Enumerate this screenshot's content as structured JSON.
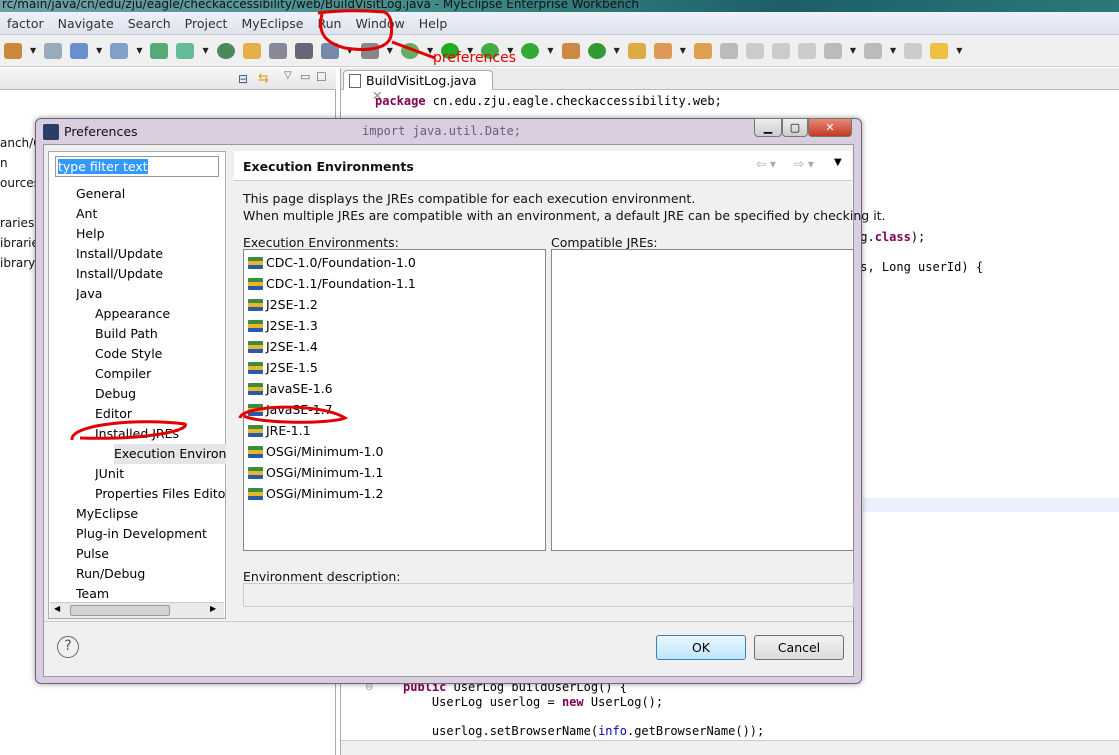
{
  "window": {
    "title": "rc/main/java/cn/edu/zju/eagle/checkaccessibility/web/BuildVisitLog.java - MyEclipse Enterprise Workbench"
  },
  "menu": [
    "factor",
    "Navigate",
    "Search",
    "Project",
    "MyEclipse",
    "Run",
    "Window",
    "Help"
  ],
  "annotation": {
    "text": "preferences",
    "color": "#e00000"
  },
  "left_panel": {
    "fragments": [
      "anch/C",
      "n",
      "ources",
      "raries",
      "ibraries",
      "ibrary"
    ]
  },
  "editor": {
    "tab": "BuildVisitLog.java",
    "lines": {
      "package_kw": "package",
      "package_rest": " cn.edu.zju.eagle.checkaccessibility.web;",
      "import": "import java.util.Date;",
      "class_pre": "og.",
      "class_kw": "class",
      "class_post": ");",
      "method_sig": "es, Long userId) {",
      "pub_kw": "public",
      "pub_rest": " UserLog buildUserLog() {",
      "ul_pre": "    UserLog userlog = ",
      "ul_new": "new",
      "ul_post": " UserLog();",
      "sb_pre": "    userlog.setBrowserName(",
      "sb_info": "info",
      "sb_post": ".getBrowserName());"
    }
  },
  "dialog": {
    "title": "Preferences",
    "filter_text": "type filter text",
    "tree": [
      {
        "label": "General",
        "level": 0
      },
      {
        "label": "Ant",
        "level": 0
      },
      {
        "label": "Help",
        "level": 0
      },
      {
        "label": "Install/Update",
        "level": 0
      },
      {
        "label": "Install/Update",
        "level": 0
      },
      {
        "label": "Java",
        "level": 0
      },
      {
        "label": "Appearance",
        "level": 1
      },
      {
        "label": "Build Path",
        "level": 1
      },
      {
        "label": "Code Style",
        "level": 1
      },
      {
        "label": "Compiler",
        "level": 1
      },
      {
        "label": "Debug",
        "level": 1
      },
      {
        "label": "Editor",
        "level": 1
      },
      {
        "label": "Installed JREs",
        "level": 1
      },
      {
        "label": "Execution Environments",
        "level": 2,
        "selected": true
      },
      {
        "label": "JUnit",
        "level": 1
      },
      {
        "label": "Properties Files Editor",
        "level": 1
      },
      {
        "label": "MyEclipse",
        "level": 0
      },
      {
        "label": "Plug-in Development",
        "level": 0
      },
      {
        "label": "Pulse",
        "level": 0
      },
      {
        "label": "Run/Debug",
        "level": 0
      },
      {
        "label": "Team",
        "level": 0
      }
    ],
    "page_title": "Execution Environments",
    "description1": "This page displays the JREs compatible for each execution environment.",
    "description2": "When multiple JREs are compatible with an environment, a default JRE can be specified by checking it.",
    "env_label": "Execution Environments:",
    "compat_label": "Compatible JREs:",
    "environments": [
      "CDC-1.0/Foundation-1.0",
      "CDC-1.1/Foundation-1.1",
      "J2SE-1.2",
      "J2SE-1.3",
      "J2SE-1.4",
      "J2SE-1.5",
      "JavaSE-1.6",
      "JavaSE-1.7",
      "JRE-1.1",
      "OSGi/Minimum-1.0",
      "OSGi/Minimum-1.1",
      "OSGi/Minimum-1.2"
    ],
    "env_desc_label": "Environment description:",
    "help": "?",
    "ok": "OK",
    "cancel": "Cancel"
  }
}
